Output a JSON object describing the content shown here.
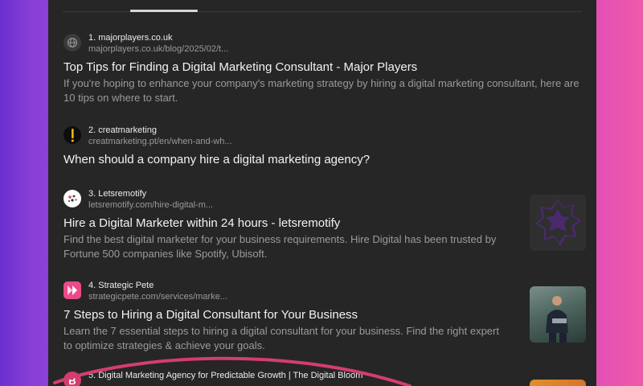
{
  "results": [
    {
      "site": "1. majorplayers.co.uk",
      "url": "majorplayers.co.uk/blog/2025/02/t...",
      "title": "Top Tips for Finding a Digital Marketing Consultant - Major Players",
      "snippet": "If you're hoping to enhance your company's marketing strategy by hiring a digital marketing consultant, here are 10 tips on where to start.",
      "icon": "globe-icon"
    },
    {
      "site": "2. creatmarketing",
      "url": "creatmarketing.pt/en/when-and-wh...",
      "title": "When should a company hire a digital marketing agency?",
      "snippet": "",
      "icon": "creatmarketing-logo-icon"
    },
    {
      "site": "3. Letsremotify",
      "url": "letsremotify.com/hire-digital-m...",
      "title": "Hire a Digital Marketer within 24 hours - letsremotify",
      "snippet": "Find the best digital marketer for your business requirements. Hire Digital has been trusted by Fortune 500 companies like Spotify, Ubisoft.",
      "icon": "letsremotify-logo-icon",
      "thumbnail": "purple-star-badge"
    },
    {
      "site": "4. Strategic Pete",
      "url": "strategicpete.com/services/marke...",
      "title": "7 Steps to Hiring a Digital Consultant for Your Business",
      "snippet": "Learn the 7 essential steps to hiring a digital consultant for your business. Find the right expert to optimize strategies & achieve your goals.",
      "icon": "strategic-pete-logo-icon",
      "thumbnail": "man-with-laptop-photo"
    },
    {
      "site": "5. Digital Marketing Agency for Predictable Growth | The Digital Bloom",
      "url": "",
      "title": "",
      "snippet": "",
      "icon": "digital-bloom-logo-icon",
      "thumbnail": "orange-thumbnail"
    }
  ],
  "colors": {
    "panel": "#262626",
    "accent_pink": "#d43d6f",
    "thumb_purple": "#4a2a6e"
  }
}
